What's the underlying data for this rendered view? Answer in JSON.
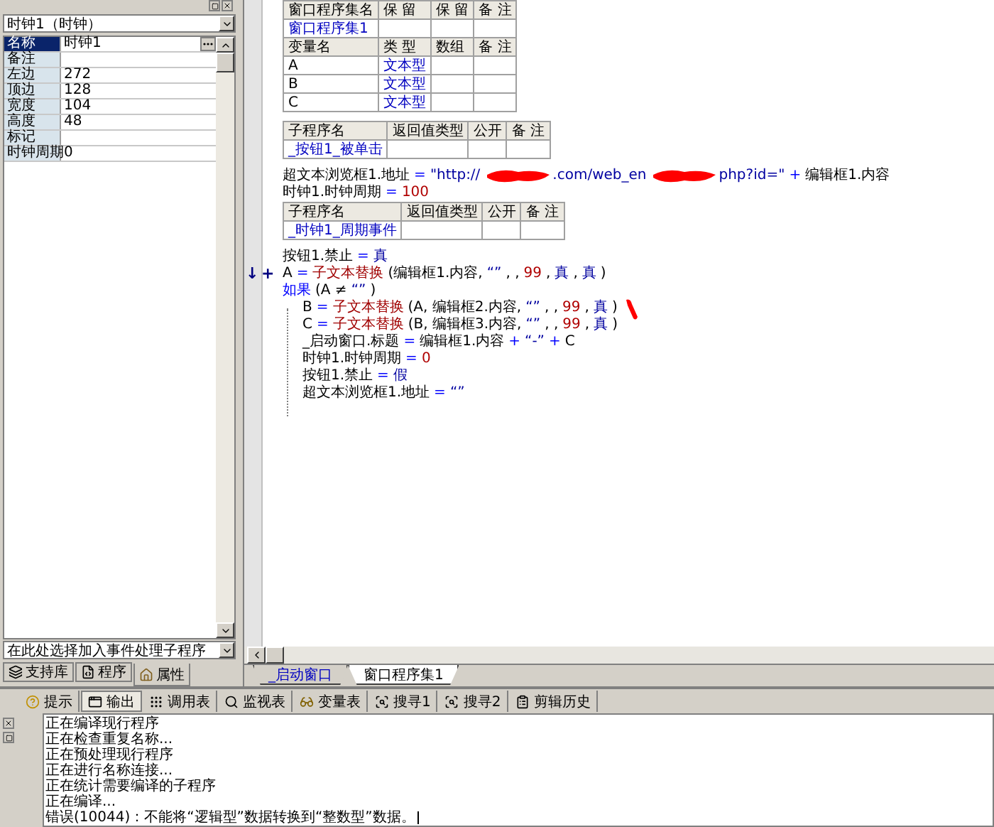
{
  "property_panel": {
    "object_selector": "时钟1（时钟）",
    "properties": [
      {
        "name": "名称",
        "value": "时钟1",
        "selected": true
      },
      {
        "name": "备注",
        "selected": false
      },
      {
        "name": "左边",
        "value": "272",
        "selected": false
      },
      {
        "name": "顶边",
        "value": "128",
        "selected": false
      },
      {
        "name": "宽度",
        "value": "104",
        "selected": false
      },
      {
        "name": "高度",
        "value": "48",
        "selected": false
      },
      {
        "name": "标记",
        "selected": false
      },
      {
        "name": "时钟周期",
        "value": "0",
        "selected": false
      }
    ],
    "event_selector": "在此处选择加入事件处理子程序",
    "tabs": [
      {
        "label": "支持库",
        "selected": false
      },
      {
        "label": "程序",
        "selected": false
      },
      {
        "label": "属性",
        "selected": true
      }
    ]
  },
  "code_editor": {
    "blocks": [
      {
        "kind": "table",
        "rows": [
          {
            "kind": "header",
            "cells": [
              "窗口程序集名",
              "保 留",
              "保 留",
              "备 注"
            ]
          },
          {
            "kind": "name",
            "cells": [
              "窗口程序集1",
              null,
              null,
              null
            ]
          },
          {
            "kind": "header",
            "cells": [
              "变量名",
              "类 型",
              "数组",
              "备 注"
            ]
          },
          {
            "kind": "var",
            "cells": [
              "A",
              "文本型",
              null,
              null
            ]
          },
          {
            "kind": "var",
            "cells": [
              "B",
              "文本型",
              null,
              null
            ]
          },
          {
            "kind": "var",
            "cells": [
              "C",
              "文本型",
              null,
              null
            ]
          }
        ]
      },
      {
        "kind": "table",
        "rows": [
          {
            "kind": "header",
            "cells": [
              "子程序名",
              "返回值类型",
              "公开",
              "备 注"
            ]
          },
          {
            "kind": "name",
            "cells": [
              "_按钮1_被单击",
              null,
              null,
              null
            ]
          }
        ]
      },
      {
        "kind": "line",
        "tokens": [
          {
            "kind": "text",
            "text": "超文本浏览框1.地址"
          },
          {
            "kind": "op",
            "text": "="
          },
          {
            "kind": "str",
            "text": "\"http://"
          },
          {
            "kind": "redaction"
          },
          {
            "kind": "str",
            "text": ".com/web_en"
          },
          {
            "kind": "redaction"
          },
          {
            "kind": "str",
            "text": "php?id=\""
          },
          {
            "kind": "op",
            "text": "+"
          },
          {
            "kind": "text",
            "text": "编辑框1.内容"
          }
        ]
      },
      {
        "kind": "line",
        "tokens": [
          {
            "kind": "text",
            "text": "时钟1.时钟周期"
          },
          {
            "kind": "op",
            "text": "="
          },
          {
            "kind": "num",
            "text": "100"
          }
        ]
      },
      {
        "kind": "table",
        "rows": [
          {
            "kind": "header",
            "cells": [
              "子程序名",
              "返回值类型",
              "公开",
              "备 注"
            ]
          },
          {
            "kind": "name",
            "cells": [
              "_时钟1_周期事件",
              null,
              null,
              null
            ]
          }
        ]
      },
      {
        "kind": "line",
        "tokens": [
          {
            "kind": "text",
            "text": "按钮1.禁止"
          },
          {
            "kind": "op",
            "text": "="
          },
          {
            "kind": "const",
            "text": "真"
          }
        ]
      },
      {
        "kind": "line",
        "gutter": [
          "↓",
          "+"
        ],
        "tokens": [
          {
            "kind": "text",
            "text": "A"
          },
          {
            "kind": "op",
            "text": "="
          },
          {
            "kind": "func",
            "text": "子文本替换"
          },
          {
            "kind": "text",
            "text": "(编辑框1.内容,"
          },
          {
            "kind": "str",
            "text": "“”"
          },
          {
            "kind": "text",
            "text": ", ,"
          },
          {
            "kind": "num",
            "text": "99"
          },
          {
            "kind": "text",
            "text": ","
          },
          {
            "kind": "const",
            "text": "真"
          },
          {
            "kind": "text",
            "text": ","
          },
          {
            "kind": "const",
            "text": "真"
          },
          {
            "kind": "text",
            "text": ")"
          }
        ]
      },
      {
        "kind": "line",
        "tokens": [
          {
            "kind": "keyword",
            "text": "如果"
          },
          {
            "kind": "text",
            "text": "(A ≠"
          },
          {
            "kind": "str",
            "text": "“”"
          },
          {
            "kind": "text",
            "text": ")"
          }
        ],
        "children": [
          {
            "kind": "line",
            "tokens": [
              {
                "kind": "text",
                "text": "B"
              },
              {
                "kind": "op",
                "text": "="
              },
              {
                "kind": "func",
                "text": "子文本替换"
              },
              {
                "kind": "text",
                "text": "(A, 编辑框2.内容,"
              },
              {
                "kind": "str",
                "text": "“”"
              },
              {
                "kind": "text",
                "text": ", ,"
              },
              {
                "kind": "num",
                "text": "99"
              },
              {
                "kind": "text",
                "text": ","
              },
              {
                "kind": "const",
                "text": "真"
              },
              {
                "kind": "text",
                "text": ")"
              }
            ]
          },
          {
            "kind": "line",
            "tokens": [
              {
                "kind": "text",
                "text": "C"
              },
              {
                "kind": "op",
                "text": "="
              },
              {
                "kind": "func",
                "text": "子文本替换"
              },
              {
                "kind": "text",
                "text": "(B, 编辑框3.内容,"
              },
              {
                "kind": "str",
                "text": "“”"
              },
              {
                "kind": "text",
                "text": ", ,"
              },
              {
                "kind": "num",
                "text": "99"
              },
              {
                "kind": "text",
                "text": ","
              },
              {
                "kind": "const",
                "text": "真"
              },
              {
                "kind": "text",
                "text": ")"
              }
            ]
          },
          {
            "kind": "line",
            "tokens": [
              {
                "kind": "text",
                "text": "_启动窗口.标题"
              },
              {
                "kind": "op",
                "text": "="
              },
              {
                "kind": "text",
                "text": "编辑框1.内容"
              },
              {
                "kind": "op",
                "text": "+"
              },
              {
                "kind": "str",
                "text": "“-”"
              },
              {
                "kind": "op",
                "text": "+"
              },
              {
                "kind": "text",
                "text": "C"
              }
            ]
          },
          {
            "kind": "line",
            "tokens": [
              {
                "kind": "text",
                "text": "时钟1.时钟周期"
              },
              {
                "kind": "op",
                "text": "="
              },
              {
                "kind": "num",
                "text": "0"
              }
            ]
          },
          {
            "kind": "line",
            "tokens": [
              {
                "kind": "text",
                "text": "按钮1.禁止"
              },
              {
                "kind": "op",
                "text": "="
              },
              {
                "kind": "const",
                "text": "假"
              }
            ]
          },
          {
            "kind": "line",
            "tokens": [
              {
                "kind": "text",
                "text": "超文本浏览框1.地址"
              },
              {
                "kind": "op",
                "text": "="
              },
              {
                "kind": "str",
                "text": "“”"
              }
            ]
          }
        ]
      }
    ],
    "tabs": [
      {
        "label": "_启动窗口",
        "selected": false
      },
      {
        "label": "窗口程序集1",
        "selected": true
      }
    ]
  },
  "output_panel": {
    "tabs": [
      {
        "label": "提示",
        "selected": false
      },
      {
        "label": "输出",
        "selected": true
      },
      {
        "label": "调用表",
        "selected": false
      },
      {
        "label": "监视表",
        "selected": false
      },
      {
        "label": "变量表",
        "selected": false
      },
      {
        "label": "搜寻1",
        "selected": false
      },
      {
        "label": "搜寻2",
        "selected": false
      },
      {
        "label": "剪辑历史",
        "selected": false
      }
    ],
    "lines": [
      "正在编译现行程序",
      "正在检查重复名称...",
      "正在预处理现行程序",
      "正在进行名称连接...",
      "正在统计需要编译的子程序",
      "正在编译...",
      "错误(10044)：不能将“逻辑型”数据转换到“整数型”数据。"
    ]
  }
}
